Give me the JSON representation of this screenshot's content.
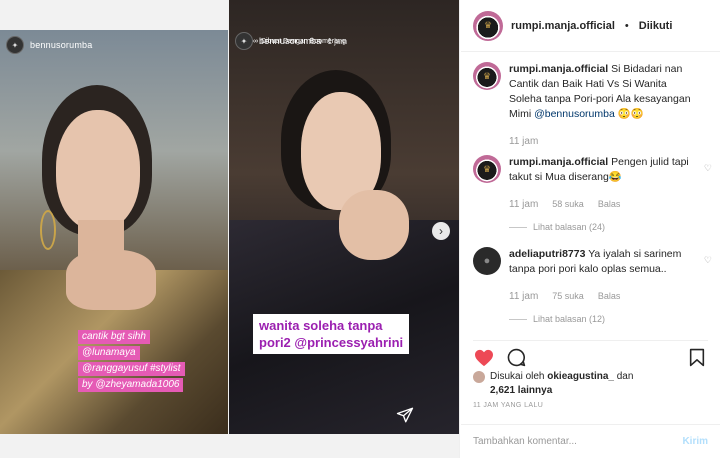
{
  "stories": [
    {
      "user": "bennusorumba",
      "stickers": [
        "cantik bgt sihh",
        "@lunamaya",
        "@ranggayusuf #stylist",
        "by @zheyamada1006"
      ]
    },
    {
      "user": "bennusorumba",
      "time": "1 jam",
      "sub": "Dibuat Dengan Boomerang",
      "caption": [
        "wanita soleha tanpa",
        "pori2 @princessyahrini"
      ]
    }
  ],
  "header": {
    "user": "rumpi.manja.official",
    "separator": "•",
    "follow_label": "Diikuti"
  },
  "comments": [
    {
      "user": "rumpi.manja.official",
      "text": "Si Bidadari nan Cantik dan Baik Hati Vs Si Wanita Soleha tanpa Pori-pori Ala kesayangan Mimi",
      "mention": "@bennusorumba",
      "emoji": "😳😳",
      "time": "11 jam"
    },
    {
      "user": "rumpi.manja.official",
      "text": "Pengen julid tapi takut si Mua diserang😂",
      "time": "11 jam",
      "likes": "58 suka",
      "reply": "Balas",
      "view_replies": "Lihat balasan (24)"
    },
    {
      "user": "adeliaputri8773",
      "text": "Ya iyalah si sarinem tanpa pori pori kalo oplas semua..",
      "time": "11 jam",
      "likes": "75 suka",
      "reply": "Balas",
      "view_replies": "Lihat balasan (12)"
    }
  ],
  "likes": {
    "prefix": "Disukai oleh",
    "user": "okieagustina_",
    "connector": "dan",
    "count": "2,621 lainnya"
  },
  "posted": "11 JAM YANG LALU",
  "add_comment": {
    "placeholder": "Tambahkan komentar...",
    "post_label": "Kirim"
  },
  "colors": {
    "heart": "#ed4956",
    "sticker": "#e55bb5",
    "caption_text": "#9b1fb0",
    "link": "#00376b",
    "post_disabled": "#b2dffc"
  }
}
